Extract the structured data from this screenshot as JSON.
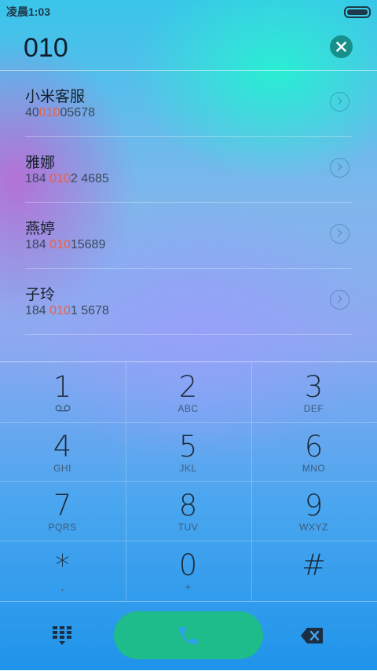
{
  "status": {
    "time": "凌晨1:03"
  },
  "query": {
    "value": "010"
  },
  "results": [
    {
      "name": "小米客服",
      "number_before": "40",
      "number_match": "010",
      "number_after": "05678"
    },
    {
      "name": "雅娜",
      "number_before": "184 ",
      "number_match": "010",
      "number_after": "2 4685"
    },
    {
      "name": "燕婷",
      "number_before": "184 ",
      "number_match": "010",
      "number_after": "15689"
    },
    {
      "name": "子玲",
      "number_before": "184 ",
      "number_match": "010",
      "number_after": "1 5678"
    }
  ],
  "keypad": [
    {
      "digit": "1",
      "letters": ""
    },
    {
      "digit": "2",
      "letters": "ABC"
    },
    {
      "digit": "3",
      "letters": "DEF"
    },
    {
      "digit": "4",
      "letters": "GHI"
    },
    {
      "digit": "5",
      "letters": "JKL"
    },
    {
      "digit": "6",
      "letters": "MNO"
    },
    {
      "digit": "7",
      "letters": "PQRS"
    },
    {
      "digit": "8",
      "letters": "TUV"
    },
    {
      "digit": "9",
      "letters": "WXYZ"
    },
    {
      "digit": "*",
      "letters": ","
    },
    {
      "digit": "0",
      "letters": "+"
    },
    {
      "digit": "#",
      "letters": ""
    }
  ],
  "colors": {
    "highlight": "#e8604a",
    "call_button": "#1ebb8b",
    "clear_button": "#178f8a"
  },
  "icons": {
    "voicemail": "voicemail-icon",
    "dialpad": "dialpad-icon",
    "call": "phone-icon",
    "backspace": "backspace-icon",
    "clear": "close-icon",
    "chevron": "chevron-right-icon"
  }
}
